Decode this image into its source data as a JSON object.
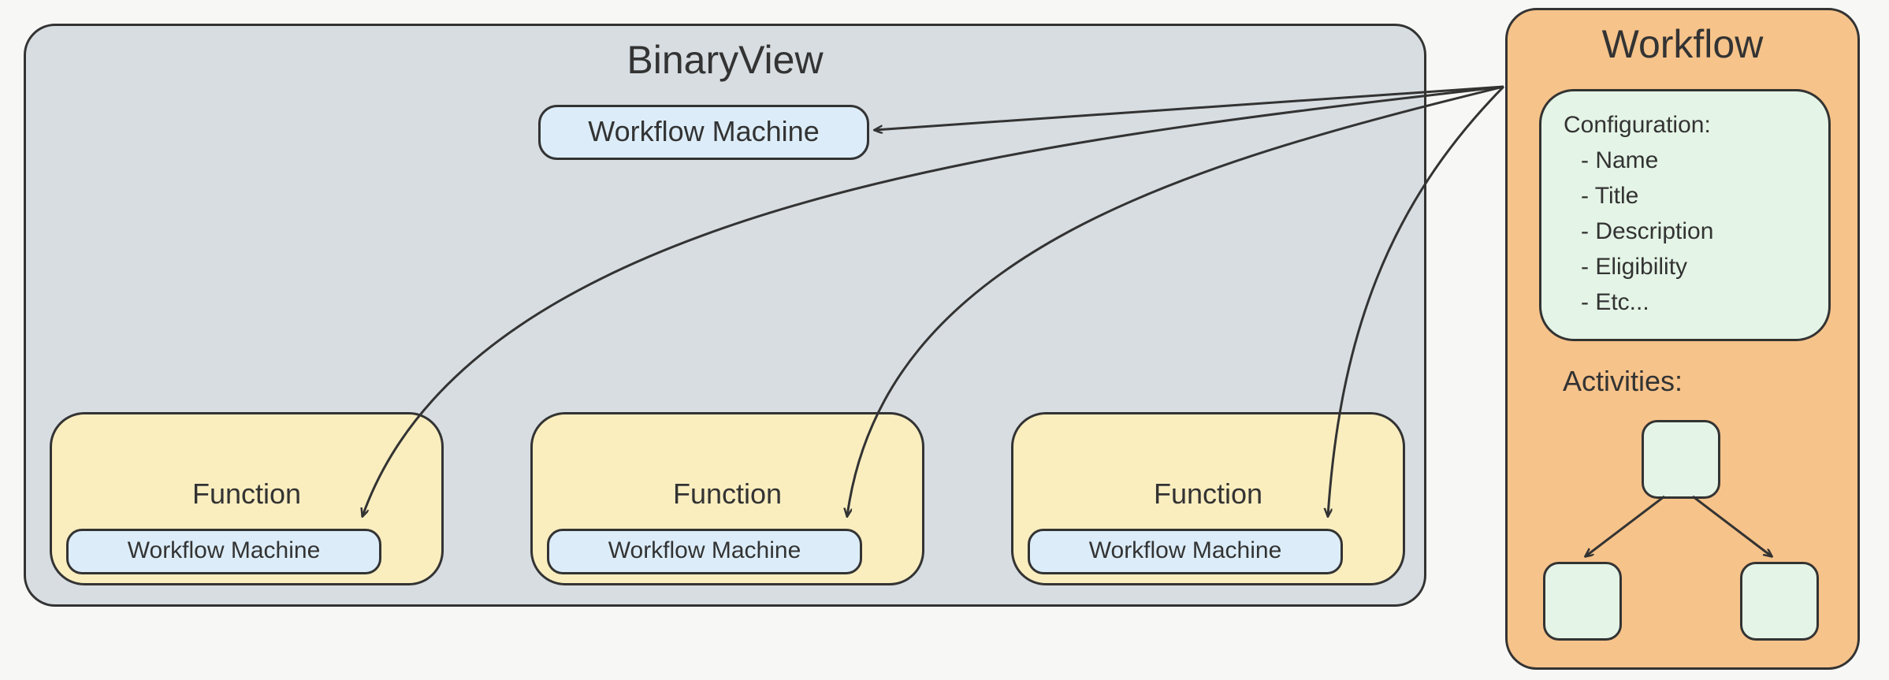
{
  "binaryview": {
    "title": "BinaryView",
    "machine_label": "Workflow Machine",
    "functions": [
      {
        "label": "Function",
        "machine_label": "Workflow Machine"
      },
      {
        "label": "Function",
        "machine_label": "Workflow Machine"
      },
      {
        "label": "Function",
        "machine_label": "Workflow Machine"
      }
    ]
  },
  "workflow": {
    "title": "Workflow",
    "configuration": {
      "heading": "Configuration:",
      "items": [
        "- Name",
        "- Title",
        "- Description",
        "- Eligibility",
        "- Etc..."
      ]
    },
    "activities_label": "Activities:"
  },
  "colors": {
    "binaryview_bg": "#d7dde1",
    "workflow_bg": "#f6c38a",
    "function_bg": "#faeebf",
    "machine_bg": "#dcedf9",
    "config_bg": "#e4f4e6",
    "activity_bg": "#e4f4e6",
    "stroke": "#333333"
  }
}
